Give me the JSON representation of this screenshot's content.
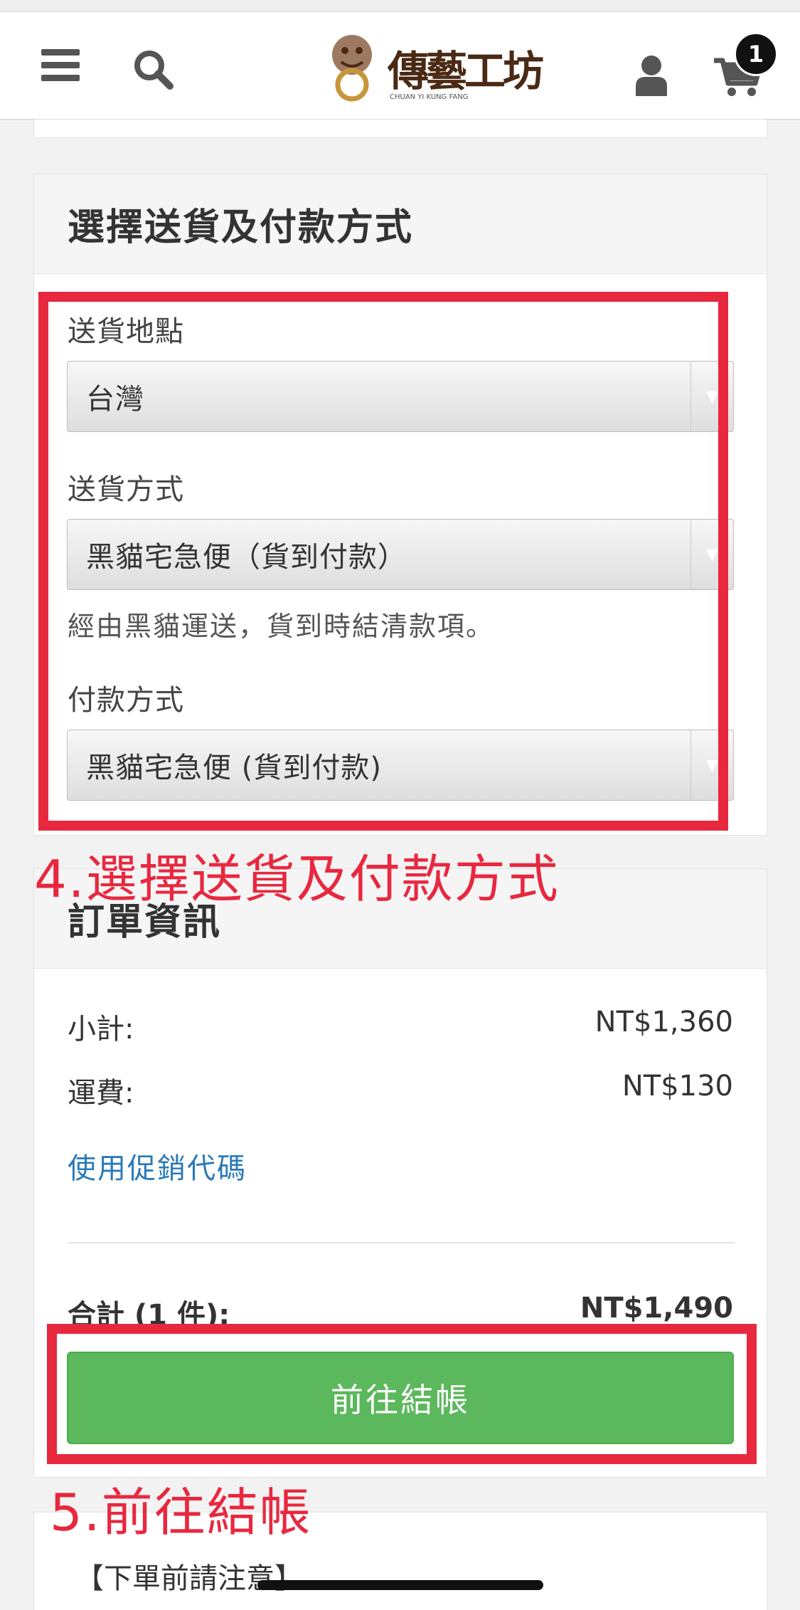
{
  "header": {
    "logo_text": "傳藝工坊",
    "logo_subtext": "CHUAN YI KUNG FANG",
    "cart_count": "1"
  },
  "shipping": {
    "title": "選擇送貨及付款方式",
    "location_label": "送貨地點",
    "location_value": "台灣",
    "method_label": "送貨方式",
    "method_value": "黑貓宅急便（貨到付款）",
    "method_helper": "經由黑貓運送，貨到時結清款項。",
    "payment_label": "付款方式",
    "payment_value": "黑貓宅急便 (貨到付款)"
  },
  "order": {
    "title": "訂單資訊",
    "subtotal_label": "小計:",
    "subtotal_value": "NT$1,360",
    "shipping_label": "運費:",
    "shipping_value": "NT$130",
    "promo_link": "使用促銷代碼",
    "total_label": "合計 (1 件):",
    "total_value": "NT$1,490",
    "checkout_label": "前往結帳"
  },
  "notes": {
    "title": "【下單前請注意】"
  },
  "annotations": {
    "step4": "4.選擇送貨及付款方式",
    "step5": "5.前往結帳",
    "color": "#e8283f"
  },
  "colors": {
    "checkout_button": "#5cb85c",
    "link": "#2a7ab8"
  }
}
